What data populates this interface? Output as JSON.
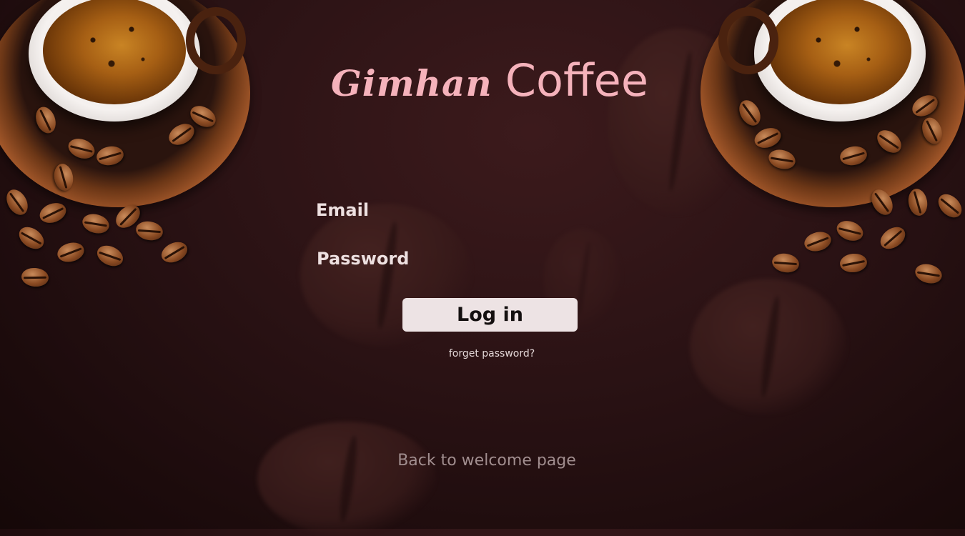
{
  "brand": {
    "script_part": "Gimhan",
    "plain_part": "Coffee",
    "color": "#f5b2bb"
  },
  "form": {
    "email_label": "Email",
    "email_value": "",
    "password_label": "Password",
    "password_value": "",
    "login_label": "Log in",
    "forgot_label": "forget password?"
  },
  "footer": {
    "back_label": "Back to welcome page"
  },
  "icons": {
    "decor_left": "coffee-cup-icon",
    "decor_right": "coffee-cup-icon"
  },
  "colors": {
    "background": "#2a1214",
    "button_bg": "#ede3e4",
    "button_text": "#141010",
    "label_text": "#ede0e0",
    "back_link_text": "#a18e8f"
  }
}
